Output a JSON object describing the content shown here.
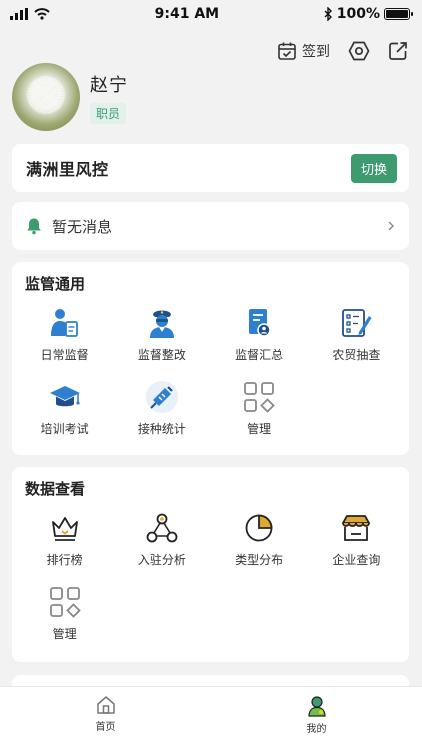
{
  "status_bar": {
    "time": "9:41 AM",
    "battery": "100%"
  },
  "header": {
    "checkin_label": "签到"
  },
  "profile": {
    "name": "赵宁",
    "role": "职员"
  },
  "org": {
    "name": "满洲里风控",
    "switch_label": "切换"
  },
  "message": {
    "text": "暂无消息"
  },
  "supervise": {
    "title": "监管通用",
    "items": [
      {
        "label": "日常监督",
        "icon": "inspector-icon"
      },
      {
        "label": "监督整改",
        "icon": "police-officer-icon"
      },
      {
        "label": "监督汇总",
        "icon": "document-summary-icon"
      },
      {
        "label": "农贸抽查",
        "icon": "checklist-edit-icon"
      },
      {
        "label": "培训考试",
        "icon": "graduation-cap-icon"
      },
      {
        "label": "接种统计",
        "icon": "syringe-icon"
      },
      {
        "label": "管理",
        "icon": "grid-manage-icon"
      }
    ]
  },
  "data_view": {
    "title": "数据查看",
    "items": [
      {
        "label": "排行榜",
        "icon": "crown-icon"
      },
      {
        "label": "入驻分析",
        "icon": "network-nodes-icon"
      },
      {
        "label": "类型分布",
        "icon": "pie-chart-icon"
      },
      {
        "label": "企业查询",
        "icon": "store-icon"
      },
      {
        "label": "管理",
        "icon": "grid-manage-icon"
      }
    ]
  },
  "tabs": [
    {
      "label": "首页",
      "icon": "home-icon"
    },
    {
      "label": "我的",
      "icon": "profile-icon"
    }
  ],
  "colors": {
    "accent": "#3e9b70",
    "background": "#f2f2f2"
  }
}
